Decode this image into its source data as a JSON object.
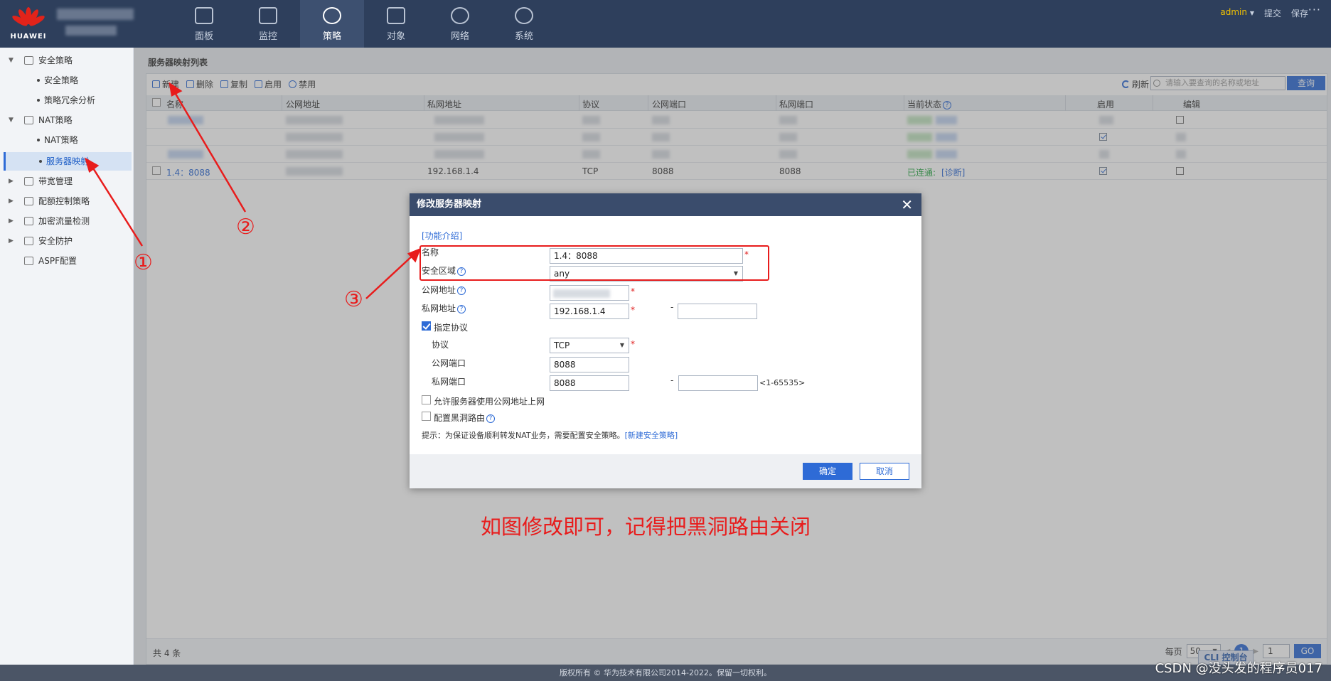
{
  "header": {
    "logo_text": "HUAWEI",
    "nav": [
      {
        "label": "面板",
        "icon": "dashboard-icon"
      },
      {
        "label": "监控",
        "icon": "monitor-icon"
      },
      {
        "label": "策略",
        "icon": "compass-icon"
      },
      {
        "label": "对象",
        "icon": "object-icon"
      },
      {
        "label": "网络",
        "icon": "network-icon"
      },
      {
        "label": "系统",
        "icon": "gear-icon"
      }
    ],
    "active_nav": "策略",
    "user": "admin",
    "submit": "提交",
    "save": "保存",
    "more": "···"
  },
  "sidebar": {
    "items": [
      {
        "label": "安全策略",
        "level": 0
      },
      {
        "label": "安全策略",
        "level": 1
      },
      {
        "label": "策略冗余分析",
        "level": 1
      },
      {
        "label": "NAT策略",
        "level": 0
      },
      {
        "label": "NAT策略",
        "level": 1
      },
      {
        "label": "服务器映射",
        "level": 1,
        "selected": true
      },
      {
        "label": "带宽管理",
        "level": 0
      },
      {
        "label": "配额控制策略",
        "level": 0
      },
      {
        "label": "加密流量检测",
        "level": 0
      },
      {
        "label": "安全防护",
        "level": 0
      },
      {
        "label": "ASPF配置",
        "level": 0
      }
    ]
  },
  "page": {
    "title": "服务器映射列表",
    "toolbar": {
      "new": "新建",
      "delete": "删除",
      "copy": "复制",
      "enable": "启用",
      "disable": "禁用",
      "refresh": "刷新",
      "search_placeholder": "请输入要查询的名称或地址",
      "search_button": "查询"
    },
    "columns": [
      "名称",
      "公网地址",
      "私网地址",
      "协议",
      "公网端口",
      "私网端口",
      "当前状态",
      "启用",
      "编辑"
    ],
    "visible_row": {
      "name": "1.4：8088",
      "private_address": "192.168.1.4",
      "protocol": "TCP",
      "public_port": "8088",
      "private_port": "8088",
      "status": "已连通:",
      "diagnose": "[诊断]"
    },
    "total": "共 4 条",
    "pager": {
      "per_page_label": "每页",
      "per_page": "50",
      "current": "1",
      "goto": "1",
      "go": "GO"
    }
  },
  "dialog": {
    "title": "修改服务器映射",
    "intro_link": "[功能介绍]",
    "name_label": "名称",
    "name_value": "1.4：8088",
    "zone_label": "安全区域",
    "zone_value": "any",
    "public_addr_label": "公网地址",
    "private_addr_label": "私网地址",
    "private_addr_value": "192.168.1.4",
    "dash": "-",
    "specify_protocol": "指定协议",
    "protocol_label": "协议",
    "protocol_value": "TCP",
    "public_port_label": "公网端口",
    "public_port_value": "8088",
    "private_port_label": "私网端口",
    "private_port_value": "8088",
    "port_range": "<1-65535>",
    "allow_public": "允许服务器使用公网地址上网",
    "blackhole": "配置黑洞路由",
    "hint": "提示：为保证设备顺利转发NAT业务，需要配置安全策略。",
    "hint_link": "[新建安全策略]",
    "ok": "确定",
    "cancel": "取消"
  },
  "annotations": {
    "marker1": "①",
    "marker2": "②",
    "marker3": "③",
    "note": "如图修改即可，记得把黑洞路由关闭",
    "color": "#e81c1c"
  },
  "footer": {
    "copyright": "版权所有 © 华为技术有限公司2014-2022。保留一切权利。",
    "cli": "CLI 控制台",
    "watermark": "CSDN @没头发的程序员017"
  },
  "colors": {
    "header_bg": "#2e3f5c",
    "accent": "#2e6bd6",
    "success": "#27a844"
  }
}
